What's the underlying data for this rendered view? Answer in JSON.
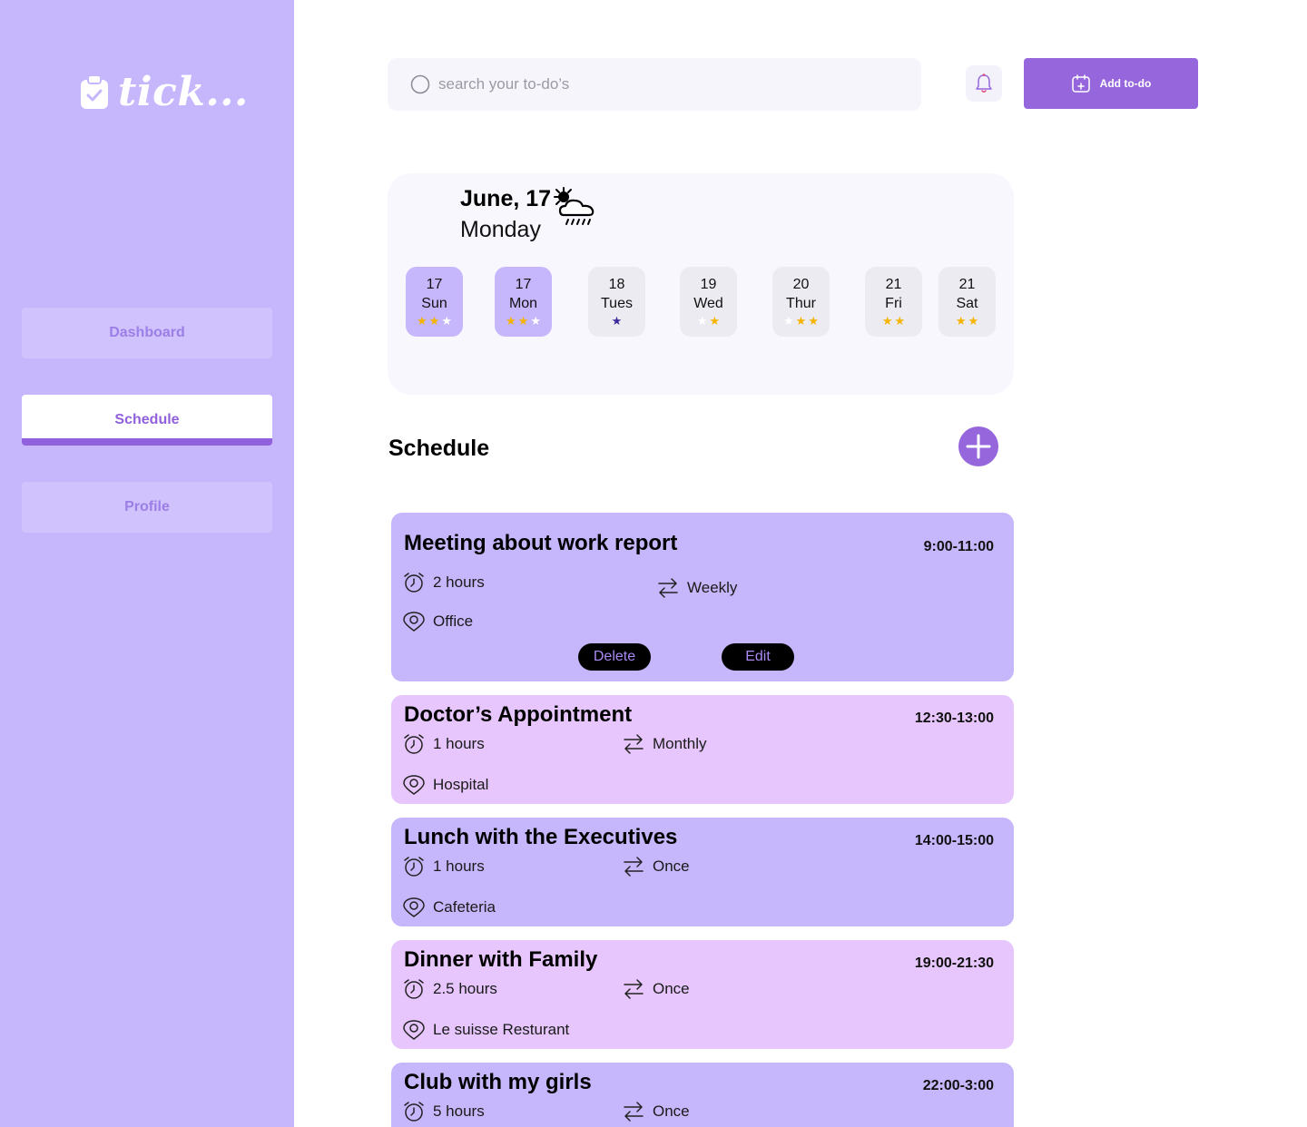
{
  "app": {
    "logo_text": "tick..."
  },
  "sidebar": {
    "items": [
      {
        "label": "Dashboard",
        "active": false
      },
      {
        "label": "Schedule",
        "active": true
      },
      {
        "label": "Profile",
        "active": false
      }
    ]
  },
  "topbar": {
    "search_placeholder": "search your to-do’s",
    "add_label": "Add to-do"
  },
  "calendar": {
    "date": "June, 17",
    "weekday": "Monday",
    "weather_icon": "sun-rain-cloud-icon",
    "days": [
      {
        "num": "17",
        "name": "Sun",
        "selected": true,
        "stars": [
          "y",
          "y",
          "w"
        ]
      },
      {
        "num": "17",
        "name": "Mon",
        "selected": true,
        "stars": [
          "y",
          "y",
          "w"
        ]
      },
      {
        "num": "18",
        "name": "Tues",
        "selected": false,
        "stars": [
          "d"
        ]
      },
      {
        "num": "19",
        "name": "Wed",
        "selected": false,
        "stars": [
          "w",
          "y"
        ]
      },
      {
        "num": "20",
        "name": "Thur",
        "selected": false,
        "stars": [
          "w",
          "y",
          "y"
        ]
      },
      {
        "num": "21",
        "name": "Fri",
        "selected": false,
        "stars": [
          "y",
          "y"
        ]
      },
      {
        "num": "21",
        "name": "Sat",
        "selected": false,
        "stars": [
          "y",
          "y"
        ]
      }
    ]
  },
  "schedule": {
    "title": "Schedule",
    "delete_label": "Delete",
    "edit_label": "Edit",
    "events": [
      {
        "title": "Meeting about work report",
        "time": "9:00-11:00",
        "duration": "2 hours",
        "repeat": "Weekly",
        "location": "Office"
      },
      {
        "title": "Doctor’s Appointment",
        "time": "12:30-13:00",
        "duration": "1 hours",
        "repeat": "Monthly",
        "location": "Hospital"
      },
      {
        "title": "Lunch with the Executives",
        "time": "14:00-15:00",
        "duration": "1 hours",
        "repeat": "Once",
        "location": "Cafeteria"
      },
      {
        "title": "Dinner with  Family",
        "time": "19:00-21:30",
        "duration": "2.5 hours",
        "repeat": "Once",
        "location": "Le suisse Resturant"
      },
      {
        "title": "Club with my girls",
        "time": "22:00-3:00",
        "duration": "5 hours",
        "repeat": "Once",
        "location": ""
      }
    ]
  },
  "colors": {
    "sidebar": "#c6b6fb",
    "accent": "#9667dc",
    "event_purple": "#c6b6fb",
    "event_pink": "#e6c6fc",
    "star": "#f5b400"
  }
}
